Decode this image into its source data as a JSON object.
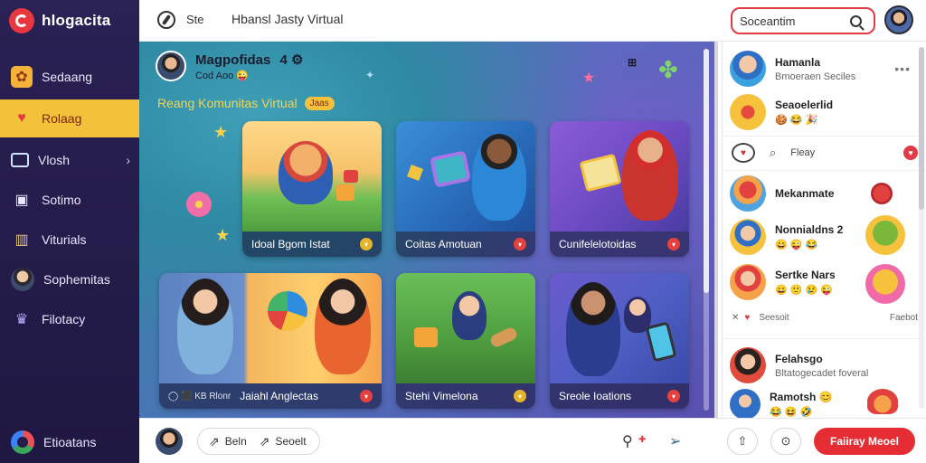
{
  "app": {
    "brand": "hlogacita"
  },
  "sidebar": {
    "items": [
      {
        "label": "Sedaang",
        "icon": "palette-icon"
      },
      {
        "label": "Rolaag",
        "icon": "heart-icon",
        "active": true
      },
      {
        "label": "Vlosh",
        "icon": "monitor-icon"
      },
      {
        "label": "Sotimo",
        "icon": "store-icon"
      },
      {
        "label": "Viturials",
        "icon": "library-icon"
      },
      {
        "label": "Sophemitas",
        "icon": "person-avatar"
      },
      {
        "label": "Filotacy",
        "icon": "crown-icon"
      }
    ],
    "footer_label": "Etioatans"
  },
  "topbar": {
    "site": "Ste",
    "path": "Hbansl Jasty Virtual",
    "search_value": "Soceantim"
  },
  "main": {
    "title": "Magpofidas",
    "title_suffix": "4 ⚙",
    "subtitle": "Cod Aoo 😜",
    "more_label": "⊞",
    "section_title": "Reang Komunitas Virtual",
    "section_badge": "Jaas",
    "cards": [
      {
        "caption": "Idoal Bgom Istat"
      },
      {
        "caption": "Coitas Amotuan"
      },
      {
        "caption": "Cunifelelotoidas"
      },
      {
        "caption": "Jaiahl Anglectas",
        "prefix": "◯ ⬛ KB Rlonr"
      },
      {
        "caption": "Stehi Vimelona"
      },
      {
        "caption": "Sreole Ioations"
      }
    ]
  },
  "rightpanel": {
    "items": [
      {
        "name": "Hamanla",
        "sub": "Bmoeraen Seciles"
      },
      {
        "name": "Seaoelerlid",
        "sub": "🍪 😂 🎉"
      },
      {
        "name": "Mekanmate",
        "sub": ""
      },
      {
        "name": "Nonnialdns 2",
        "sub": "😄 😜 😂"
      },
      {
        "name": "Sertke Nars",
        "sub": "😄 🙂 😢 😜"
      },
      {
        "name": "Felahsgo",
        "sub": "Bltatogecadet foveral"
      },
      {
        "name": "Ramotsh 😊",
        "sub": "😂 😆 🤣"
      }
    ],
    "react_label": "Fleay",
    "foot_left": "Seesoit",
    "foot_right": "Faebot"
  },
  "bottombar": {
    "left_label": "Beln",
    "right_label": "Seoelt",
    "cta": "Faiiray Meoel"
  }
}
